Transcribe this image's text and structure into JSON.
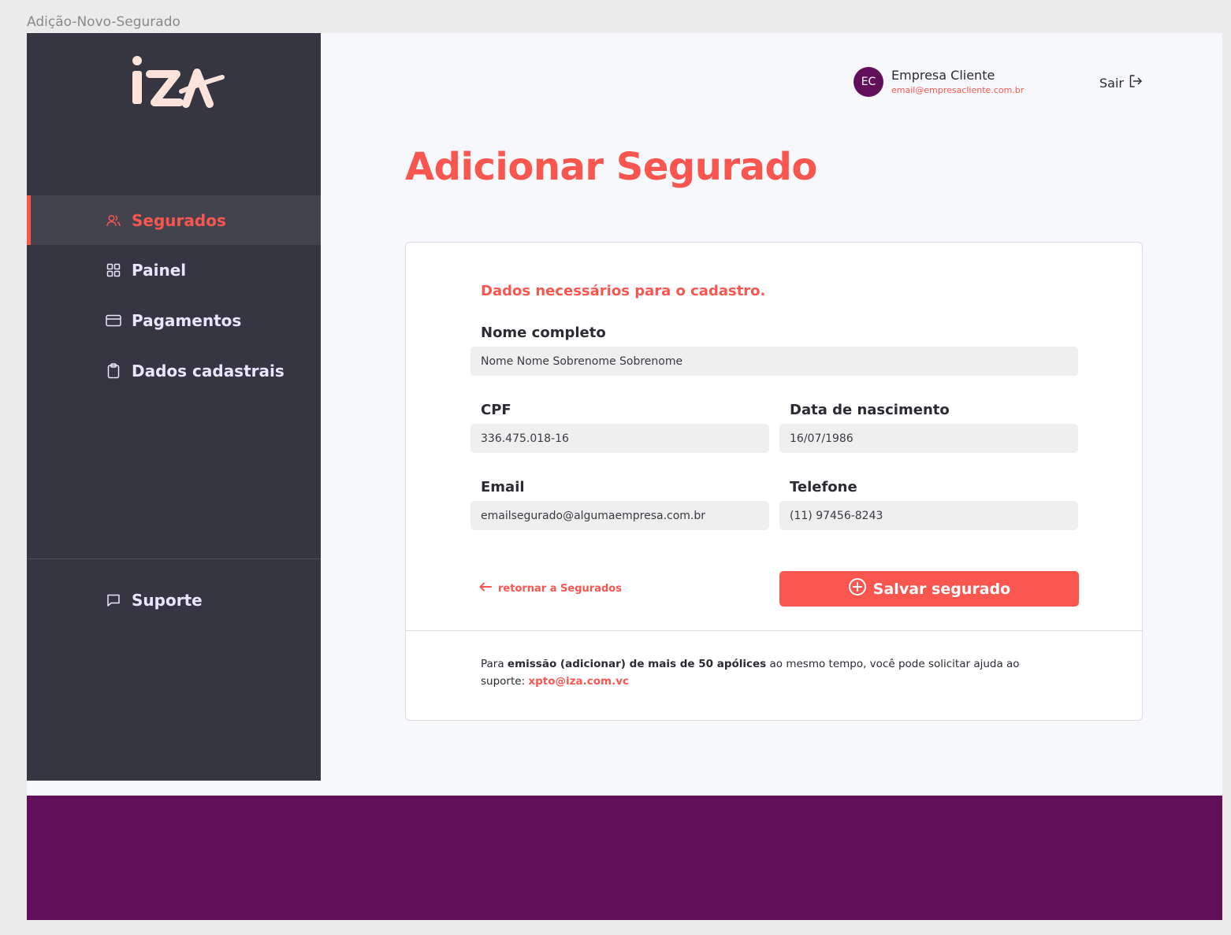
{
  "frame_label": "Adição-Novo-Segurado",
  "brand": {
    "logo_text": "iza",
    "primary_color": "#fa5650",
    "sidebar_color": "#363642",
    "footer_color": "#620f5a"
  },
  "sidebar": {
    "items": [
      {
        "label": "Segurados",
        "icon": "users-icon",
        "active": true
      },
      {
        "label": "Painel",
        "icon": "grid-icon",
        "active": false
      },
      {
        "label": "Pagamentos",
        "icon": "credit-card-icon",
        "active": false
      },
      {
        "label": "Dados cadastrais",
        "icon": "clipboard-icon",
        "active": false
      }
    ],
    "support": {
      "label": "Suporte",
      "icon": "chat-icon"
    }
  },
  "header": {
    "avatar_initials": "EC",
    "company_name": "Empresa Cliente",
    "company_email": "email@empresacliente.com.br",
    "logout_label": "Sair"
  },
  "page_title": "Adicionar Segurado",
  "form": {
    "section_title": "Dados necessários para o cadastro.",
    "fields": {
      "name": {
        "label": "Nome completo",
        "value": "Nome Nome Sobrenome Sobrenome"
      },
      "cpf": {
        "label": "CPF",
        "value": "336.475.018-16"
      },
      "birthdate": {
        "label": "Data de nascimento",
        "value": "16/07/1986"
      },
      "email": {
        "label": "Email",
        "value": "emailsegurado@algumaempresa.com.br"
      },
      "phone": {
        "label": "Telefone",
        "value": "(11) 97456-8243"
      }
    },
    "back_link": "retornar a Segurados",
    "save_button": "Salvar segurado"
  },
  "help": {
    "prefix": "Para ",
    "bold": "emissão (adicionar) de mais de 50 apólices",
    "middle": " ao mesmo tempo, você pode solicitar ajuda ao suporte: ",
    "email": "xpto@iza.com.vc"
  }
}
